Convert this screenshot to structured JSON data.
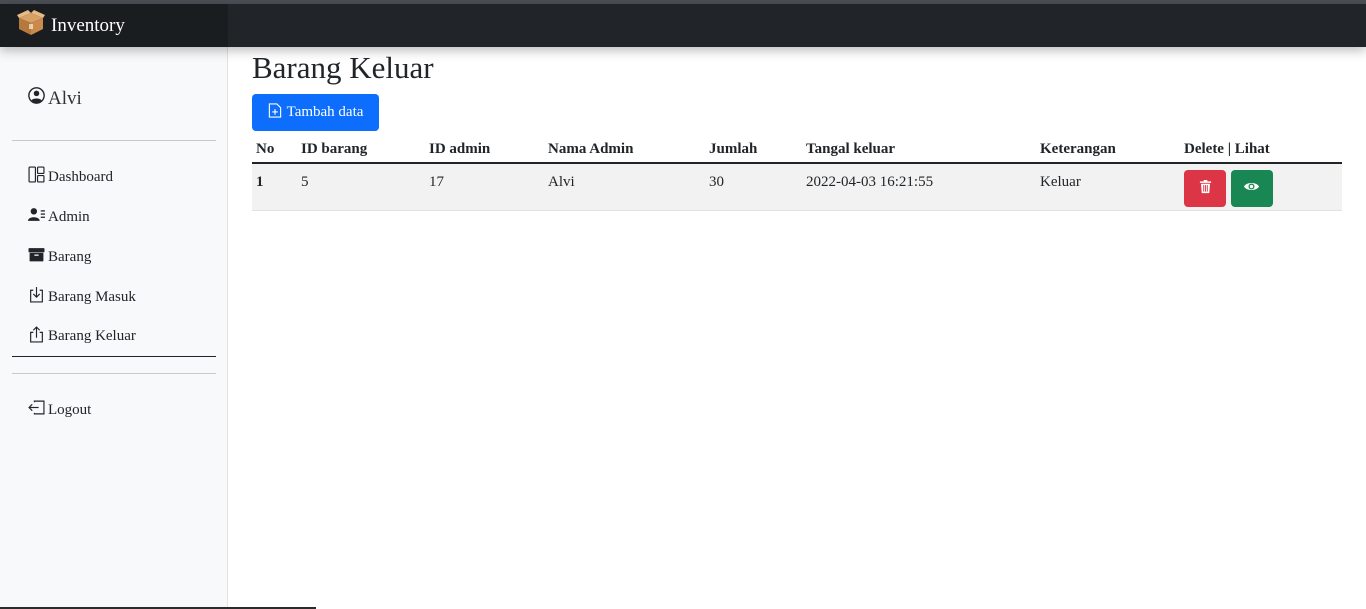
{
  "app": {
    "brand": "Inventory",
    "brand_icon": "box-open-icon"
  },
  "sidebar": {
    "user": "Alvi",
    "items": [
      {
        "label": "Dashboard",
        "icon": "dashboard-icon"
      },
      {
        "label": "Admin",
        "icon": "admin-icon"
      },
      {
        "label": "Barang",
        "icon": "box-icon"
      },
      {
        "label": "Barang Masuk",
        "icon": "box-arrow-in-icon"
      },
      {
        "label": "Barang Keluar",
        "icon": "box-arrow-up-icon",
        "active": true
      }
    ],
    "logout": "Logout"
  },
  "main": {
    "title": "Barang Keluar",
    "add_button": "Tambah data",
    "table": {
      "headers": [
        "No",
        "ID barang",
        "ID admin",
        "Nama Admin",
        "Jumlah",
        "Tangal keluar",
        "Keterangan",
        "Delete | Lihat"
      ],
      "rows": [
        [
          "1",
          "5",
          "17",
          "Alvi",
          "30",
          "2022-04-03 16:21:55",
          "Keluar"
        ]
      ]
    }
  },
  "colors": {
    "primary": "#0d6efd",
    "danger": "#dc3545",
    "success": "#198754",
    "navbar": "#212529"
  }
}
